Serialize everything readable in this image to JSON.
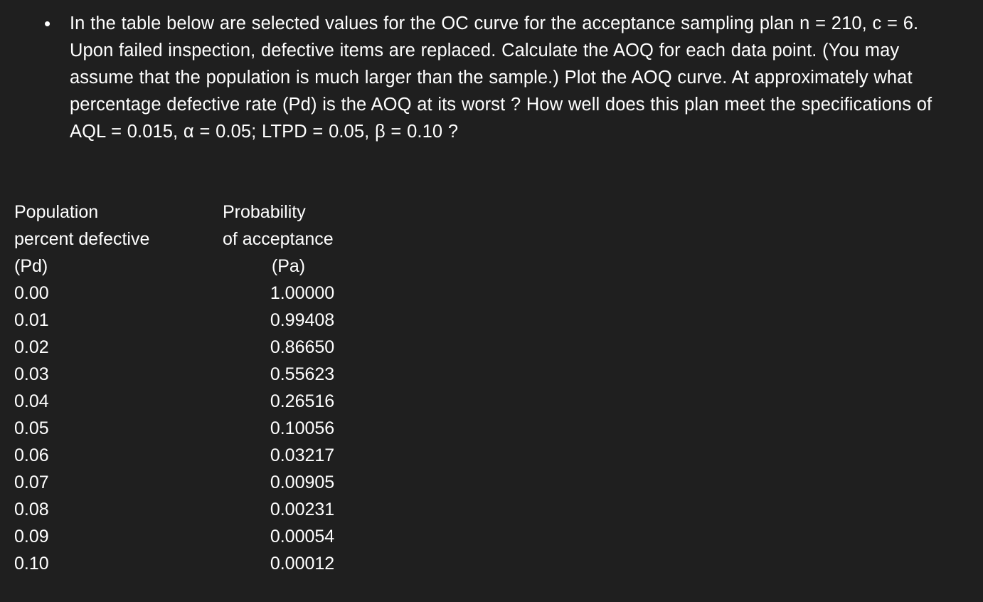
{
  "slide": {
    "background_color": "#1f1f1f",
    "text_color": "#ffffff"
  },
  "question": {
    "bullet_glyph": "•",
    "text": "In the table below are selected values for the OC curve for the acceptance sampling plan n = 210, c = 6. Upon failed inspection, defective items are replaced. Calculate the AOQ for each data point. (You may assume that the population is much larger than the sample.) Plot the AOQ curve. At approximately what percentage defective rate (Pd) is the AOQ at its worst ? How well does this plan meet the specifications of AQL = 0.015, α = 0.05; LTPD = 0.05, β = 0.10 ?"
  },
  "table": {
    "headers": {
      "pd": {
        "line1": "Population",
        "line2": "percent defective",
        "line3": "(Pd)"
      },
      "pa": {
        "line1": "Probability",
        "line2": "of acceptance",
        "line3": "(Pa)"
      }
    },
    "rows": [
      {
        "pd": "0.00",
        "pa": "1.00000"
      },
      {
        "pd": "0.01",
        "pa": "0.99408"
      },
      {
        "pd": "0.02",
        "pa": "0.86650"
      },
      {
        "pd": "0.03",
        "pa": "0.55623"
      },
      {
        "pd": "0.04",
        "pa": "0.26516"
      },
      {
        "pd": "0.05",
        "pa": "0.10056"
      },
      {
        "pd": "0.06",
        "pa": "0.03217"
      },
      {
        "pd": "0.07",
        "pa": "0.00905"
      },
      {
        "pd": "0.08",
        "pa": "0.00231"
      },
      {
        "pd": "0.09",
        "pa": "0.00054"
      },
      {
        "pd": "0.10",
        "pa": "0.00012"
      }
    ]
  },
  "chart_data": {
    "type": "table",
    "title": "OC curve selected values for acceptance sampling plan n = 210, c = 6",
    "xlabel": "Population percent defective (Pd)",
    "ylabel": "Probability of acceptance (Pa)",
    "x": [
      0.0,
      0.01,
      0.02,
      0.03,
      0.04,
      0.05,
      0.06,
      0.07,
      0.08,
      0.09,
      0.1
    ],
    "series": [
      {
        "name": "Probability of acceptance (Pa)",
        "values": [
          1.0,
          0.99408,
          0.8665,
          0.55623,
          0.26516,
          0.10056,
          0.03217,
          0.00905,
          0.00231,
          0.00054,
          0.00012
        ]
      }
    ],
    "columns": [
      "Population percent defective (Pd)",
      "Probability of acceptance (Pa)"
    ],
    "parameters": {
      "n": 210,
      "c": 6,
      "AQL": 0.015,
      "alpha": 0.05,
      "LTPD": 0.05,
      "beta": 0.1
    }
  }
}
